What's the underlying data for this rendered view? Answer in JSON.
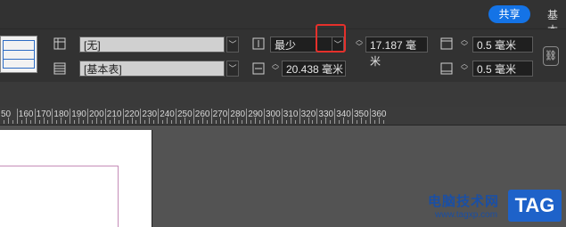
{
  "header": {
    "share_label": "共享",
    "extra_label": "基本"
  },
  "table_style": {
    "row1": {
      "value": "[无]"
    },
    "row2": {
      "value": "[基本表]"
    }
  },
  "row_height": {
    "mode": "最少",
    "value": "17.187 毫米"
  },
  "column_width": {
    "value": "20.438 毫米"
  },
  "top_inset": {
    "value": "0.5 毫米"
  },
  "bottom_inset": {
    "value": "0.5 毫米"
  },
  "ruler": {
    "labels": [
      "50",
      "160",
      "170",
      "180",
      "190",
      "200",
      "210",
      "220",
      "230",
      "240",
      "250",
      "260",
      "270",
      "280",
      "290",
      "300",
      "310",
      "320",
      "330",
      "340",
      "350",
      "360"
    ]
  },
  "watermark": {
    "text": "电脑技术网",
    "url": "www.tagxp.com",
    "tag": "TAG"
  },
  "colors": {
    "accent": "#1473e6",
    "highlight": "#e5302b",
    "watermark": "#1b4fa3"
  }
}
